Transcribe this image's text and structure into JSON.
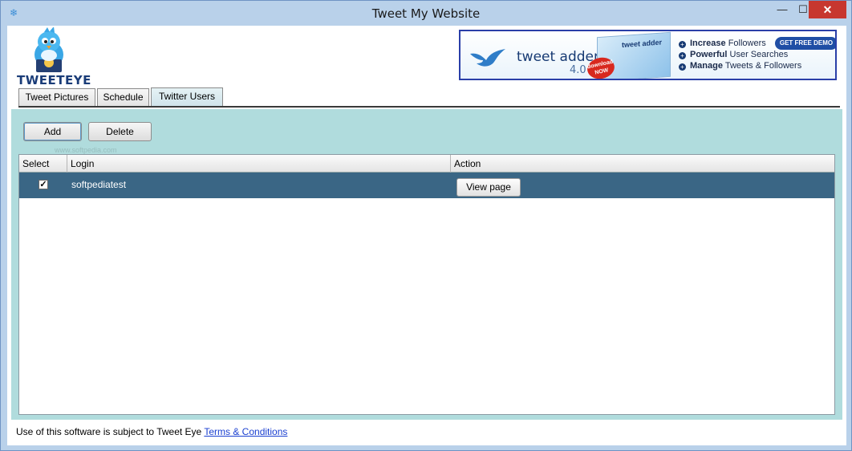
{
  "window": {
    "title": "Tweet My Website",
    "app_icon": "snowflake-icon",
    "controls": {
      "minimize": "—",
      "maximize": "☐",
      "close": "✕"
    }
  },
  "logo": {
    "text": "TWEETEYE",
    "icon": "bird-mascot-icon"
  },
  "banner": {
    "product": "tweet adder",
    "version": "4.0",
    "box_label": "tweet adder",
    "download_badge": "download NOW",
    "demo_button": "GET FREE DEMO",
    "features": [
      {
        "bold": "Increase",
        "rest": " Followers"
      },
      {
        "bold": "Powerful",
        "rest": " User Searches"
      },
      {
        "bold": "Manage",
        "rest": " Tweets & Followers"
      }
    ]
  },
  "tabs": [
    {
      "label": "Tweet Pictures",
      "active": false
    },
    {
      "label": "Schedule",
      "active": false
    },
    {
      "label": "Twitter Users",
      "active": true
    }
  ],
  "toolbar": {
    "add_label": "Add",
    "delete_label": "Delete"
  },
  "watermark": "www.softpedia.com",
  "table": {
    "columns": [
      "Select",
      "Login",
      "Action"
    ],
    "rows": [
      {
        "selected": true,
        "check": "✓",
        "login": "softpediatest",
        "action_label": "View page"
      }
    ]
  },
  "footer": {
    "text": "Use of this software is subject to Tweet Eye ",
    "link": "Terms & Conditions"
  },
  "colors": {
    "title_bar": "#b9d1ea",
    "panel_bg": "#b0dcdd",
    "selected_row": "#3a6685",
    "close_button": "#c7372f",
    "banner_border": "#2a3fa8",
    "link": "#1a3fd0"
  }
}
